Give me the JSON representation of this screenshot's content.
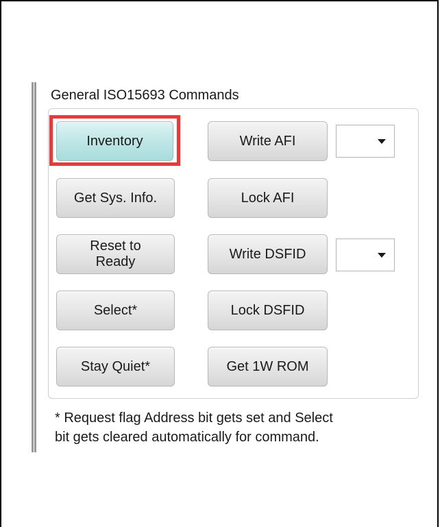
{
  "group": {
    "title": "General ISO15693 Commands"
  },
  "buttons": {
    "inventory": "Inventory",
    "get_sys_info": "Get Sys. Info.",
    "reset_to_ready_line1": "Reset to",
    "reset_to_ready_line2": "Ready",
    "select": "Select*",
    "stay_quiet": "Stay Quiet*",
    "write_afi": "Write AFI",
    "lock_afi": "Lock AFI",
    "write_dsfid": "Write DSFID",
    "lock_dsfid": "Lock DSFID",
    "get_1w_rom": "Get 1W ROM"
  },
  "dropdowns": {
    "afi_value": "",
    "dsfid_value": ""
  },
  "footnote": {
    "line1": "* Request flag Address bit gets set and Select",
    "line2": "bit gets cleared automatically for command."
  },
  "colors": {
    "highlight": "#e53b3b",
    "primary_button": "#bfe6e6"
  }
}
